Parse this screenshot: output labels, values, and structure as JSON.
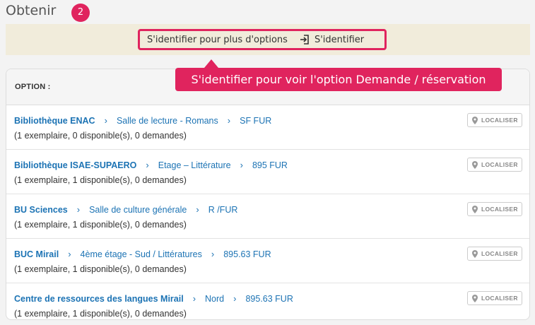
{
  "section": {
    "title": "Obtenir",
    "step": "2"
  },
  "signin": {
    "prompt": "S'identifier pour plus d'options",
    "link_label": "S'identifier"
  },
  "callout": {
    "text": "S'identifier pour voir l'option Demande / réservation"
  },
  "table": {
    "header": "OPTION :",
    "locate_label": "LOCALISER",
    "rows": [
      {
        "library": "Bibliothèque ENAC",
        "location": "Salle de lecture - Romans",
        "call_number": "SF FUR",
        "details": "(1 exemplaire, 0 disponible(s), 0 demandes)"
      },
      {
        "library": "Bibliothèque ISAE-SUPAERO",
        "location": "Etage – Littérature",
        "call_number": "895 FUR",
        "details": "(1 exemplaire, 1 disponible(s), 0 demandes)"
      },
      {
        "library": "BU Sciences",
        "location": "Salle de culture générale",
        "call_number": "R /FUR",
        "details": "(1 exemplaire, 1 disponible(s), 0 demandes)"
      },
      {
        "library": "BUC Mirail",
        "location": "4ème étage - Sud / Littératures",
        "call_number": "895.63 FUR",
        "details": "(1 exemplaire, 1 disponible(s), 0 demandes)"
      },
      {
        "library": "Centre de ressources des langues Mirail",
        "location": "Nord",
        "call_number": "895.63 FUR",
        "details": "(1 exemplaire, 1 disponible(s), 0 demandes)"
      }
    ]
  },
  "colors": {
    "accent": "#e0245e",
    "link": "#1c73b4",
    "banner_bg": "#f1ecdb"
  },
  "icons": {
    "signin": "sign-in-icon",
    "locate": "map-pin-icon",
    "separator": "chevron-right-icon"
  }
}
